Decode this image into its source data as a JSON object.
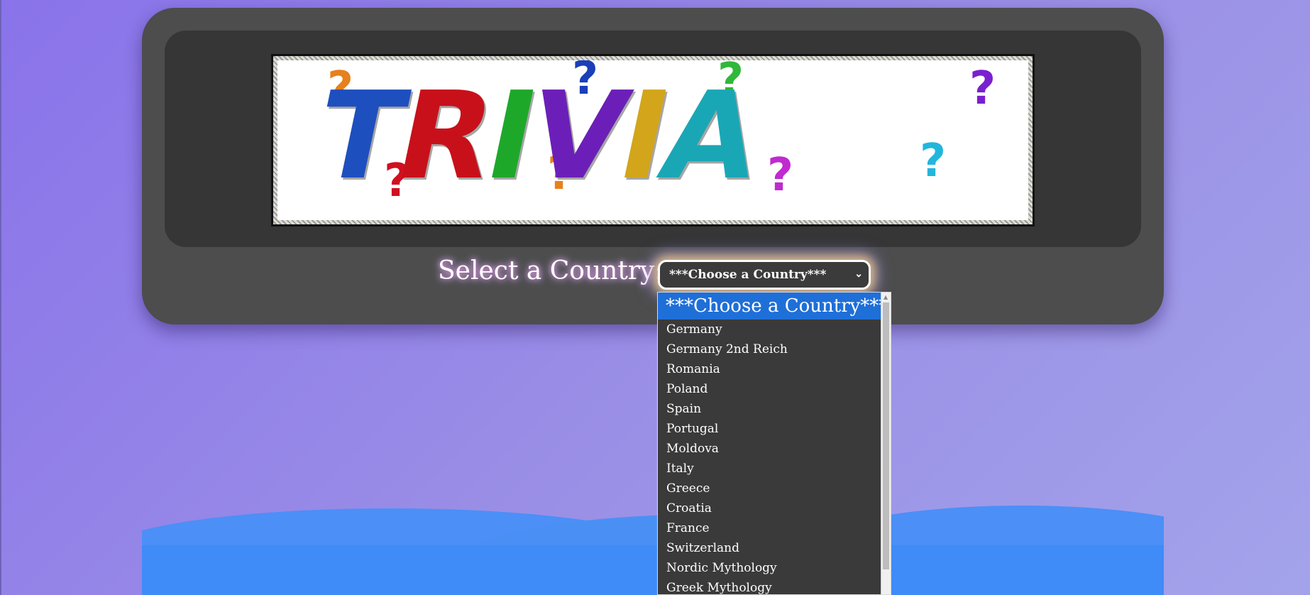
{
  "banner": {
    "logo_text": "TRIVIA",
    "letters": [
      {
        "char": "T",
        "color": "#1e4fbf"
      },
      {
        "char": "R",
        "color": "#c8101a"
      },
      {
        "char": "I",
        "color": "#1ea82a"
      },
      {
        "char": "V",
        "color": "#6b1fb8"
      },
      {
        "char": "I",
        "color": "#d2a51a"
      },
      {
        "char": "A",
        "color": "#1aa7b5"
      }
    ]
  },
  "selector": {
    "label": "Select a Country:",
    "selected_value": "***Choose a Country***"
  },
  "dropdown": {
    "options": [
      "***Choose a Country***",
      "Germany",
      "Germany 2nd Reich",
      "Romania",
      "Poland",
      "Spain",
      "Portugal",
      "Moldova",
      "Italy",
      "Greece",
      "Croatia",
      "France",
      "Switzerland",
      "Nordic Mythology",
      "Greek Mythology"
    ],
    "highlight_color": "#1f6fd8"
  },
  "colors": {
    "background": "#8a73ea",
    "card": "#4d4d4d",
    "wave": "#3f8bf8"
  }
}
